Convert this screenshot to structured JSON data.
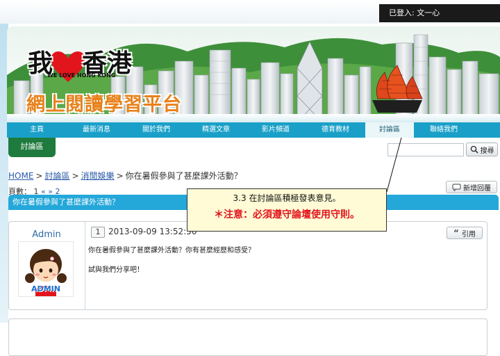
{
  "header": {
    "login_text": "已登入: 文一心",
    "logo_line1": "我",
    "logo_line1b": "香港",
    "logo_sub": "WE LOVE HONG KONG",
    "logo_line2": "網上閱讀學習平台"
  },
  "nav": {
    "items": [
      {
        "label": "主頁"
      },
      {
        "label": "最新消息"
      },
      {
        "label": "關於我們"
      },
      {
        "label": "精選文章"
      },
      {
        "label": "影片頻道"
      },
      {
        "label": "德育教材"
      },
      {
        "label": "討論區"
      },
      {
        "label": "聯絡我們"
      }
    ],
    "active_index": 6
  },
  "section": {
    "tab_label": "討論區"
  },
  "search": {
    "placeholder": "",
    "button_label": "搜尋"
  },
  "breadcrumb": {
    "home": "HOME",
    "forum": "討論區",
    "category": "消閒娛樂",
    "current": "你在暑假參與了甚麼課外活動？",
    "sep": ">"
  },
  "pager": {
    "label": "頁數：",
    "current": "1",
    "prev": "«",
    "next": "»",
    "next_page": "2"
  },
  "actions": {
    "new_reply_label": "新增回覆",
    "quote_label": "引用"
  },
  "thread": {
    "title": "你在暑假參與了甚麼課外活動？"
  },
  "post": {
    "author": "Admin",
    "avatar_badge": "ADMIN",
    "number": "1",
    "datetime": "2013-09-09 13:52:50",
    "line1": "你在暑假參與了甚麼課外活動？你有甚麼經歷和感受？",
    "line2": "試與我們分享吧！"
  },
  "callout": {
    "title": "3.3 在討論區積極發表意見。",
    "note": "＊注意：必須遵守論壇使用守則。"
  },
  "colors": {
    "nav_bg": "#1aa0c8",
    "thread_bar": "#24a7d9",
    "section_tab": "#1f7a3e",
    "callout_bg": "#fffbd6",
    "callout_note": "#e2141c",
    "link": "#2a59a8"
  }
}
